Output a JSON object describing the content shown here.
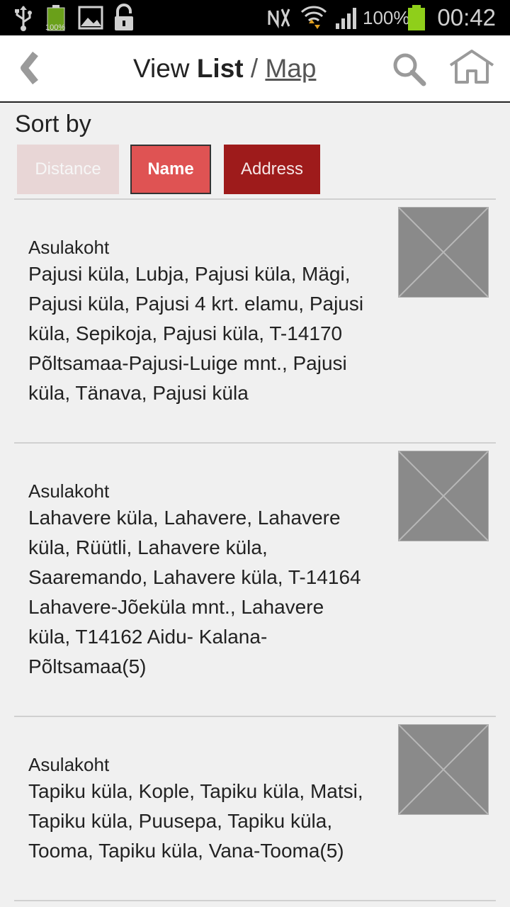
{
  "status_bar": {
    "battery_small_label": "100%",
    "battery_percent": "100%",
    "clock": "00:42",
    "colors": {
      "battery_green": "#8fcf1a",
      "wifi_arrows": "#e0a020"
    }
  },
  "header": {
    "title_view": "View",
    "title_list": "List",
    "title_slash": "/",
    "title_map": "Map"
  },
  "sort": {
    "label": "Sort by",
    "buttons": {
      "distance": "Distance",
      "name": "Name",
      "address": "Address"
    },
    "selected": "Name"
  },
  "items": [
    {
      "category": "Asulakoht",
      "address_lines": [
        "Pajusi küla, Lubja, Pajusi küla, Mägi,",
        "Pajusi küla, Pajusi 4 krt. elamu, Pajusi",
        "küla, Sepikoja, Pajusi küla, T-14170",
        "Põltsamaa-Pajusi-Luige mnt., Pajusi",
        "küla, Tänava, Pajusi küla"
      ]
    },
    {
      "category": "Asulakoht",
      "address_lines": [
        "Lahavere küla, Lahavere, Lahavere",
        "küla, Rüütli, Lahavere küla,",
        "Saaremando, Lahavere küla, T-14164",
        "Lahavere-Jõeküla mnt., Lahavere",
        "küla, T14162 Aidu- Kalana-",
        "Põltsamaa(5)"
      ]
    },
    {
      "category": "Asulakoht",
      "address_lines": [
        "Tapiku küla, Kople, Tapiku küla, Matsi,",
        "Tapiku küla, Puusepa, Tapiku küla,",
        "Tooma, Tapiku küla, Vana-Tooma(5)"
      ]
    }
  ],
  "icons": {
    "usb": "usb-icon",
    "gallery": "gallery-icon",
    "lock": "lock-icon",
    "nfc": "nfc-icon",
    "wifi": "wifi-icon",
    "signal": "signal-icon",
    "back": "back-icon",
    "search": "search-icon",
    "home": "home-icon",
    "placeholder": "image-placeholder-icon"
  }
}
